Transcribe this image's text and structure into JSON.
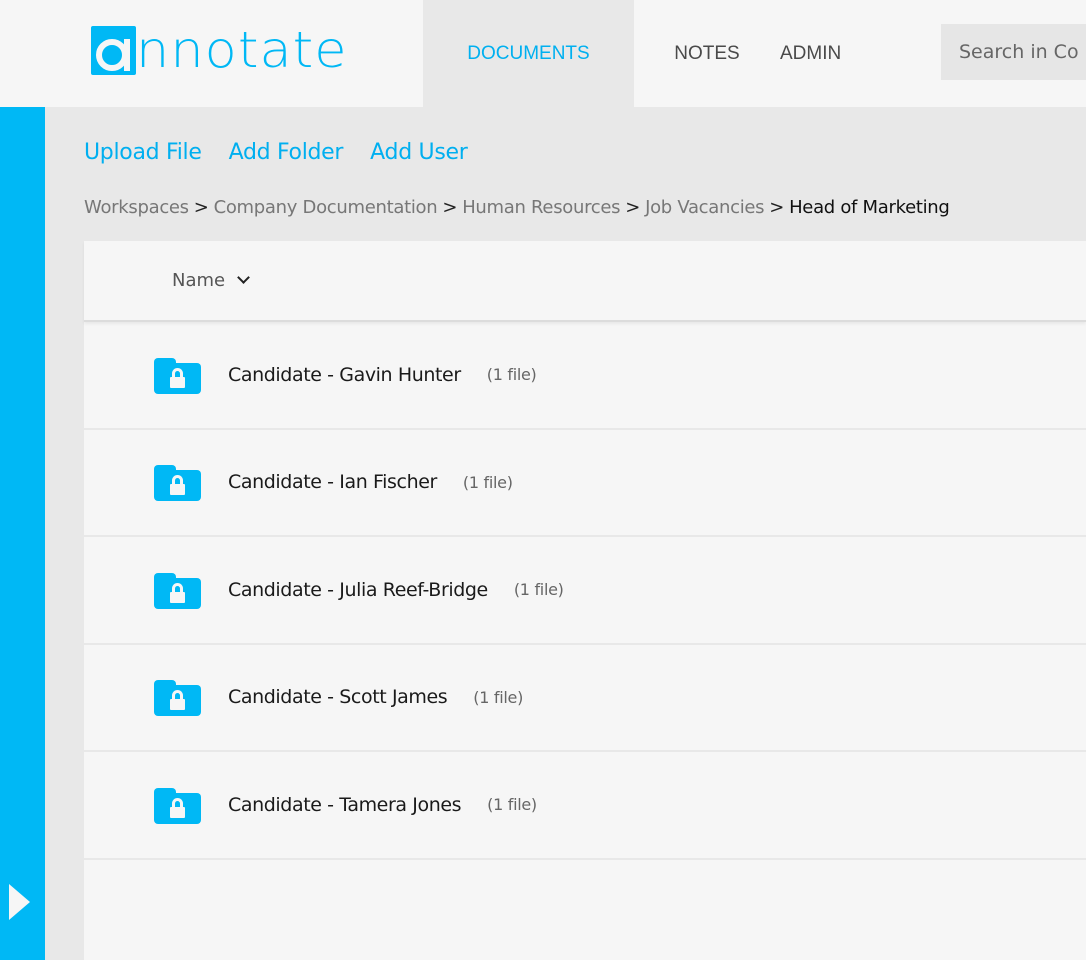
{
  "app": {
    "logo_text": "nnotate",
    "brand_color": "#00b8f5"
  },
  "nav": {
    "items": [
      {
        "label": "DOCUMENTS",
        "active": true
      },
      {
        "label": "NOTES",
        "active": false
      },
      {
        "label": "ADMIN",
        "active": false
      }
    ],
    "search_placeholder": "Search in Co"
  },
  "actions": {
    "upload_file": "Upload File",
    "add_folder": "Add Folder",
    "add_user": "Add User"
  },
  "breadcrumb": {
    "items": [
      "Workspaces",
      "Company Documentation",
      "Human Resources",
      "Job Vacancies"
    ],
    "separator": ">",
    "current": "Head of Marketing"
  },
  "list": {
    "sort_column": "Name",
    "rows": [
      {
        "name": "Candidate - Gavin Hunter",
        "count": "(1 file)",
        "icon": "locked-folder-icon"
      },
      {
        "name": "Candidate - Ian Fischer",
        "count": "(1 file)",
        "icon": "locked-folder-icon"
      },
      {
        "name": "Candidate - Julia Reef-Bridge",
        "count": "(1 file)",
        "icon": "locked-folder-icon"
      },
      {
        "name": "Candidate - Scott James",
        "count": "(1 file)",
        "icon": "locked-folder-icon"
      },
      {
        "name": "Candidate - Tamera Jones",
        "count": "(1 file)",
        "icon": "locked-folder-icon"
      }
    ]
  }
}
